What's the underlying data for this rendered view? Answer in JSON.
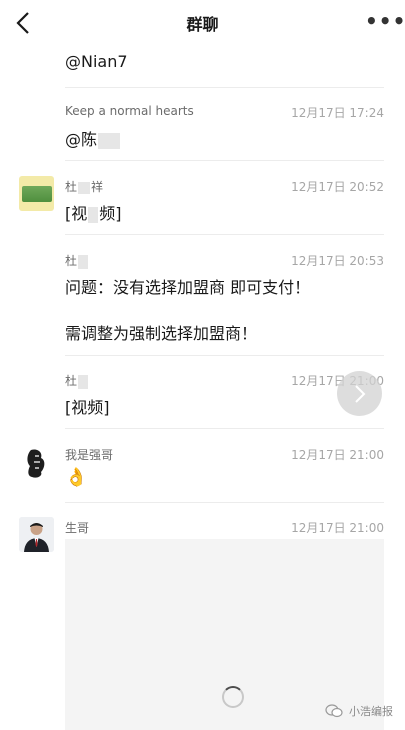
{
  "navbar": {
    "title": "群聊"
  },
  "messages": [
    {
      "id": "m0",
      "content": "@Nian7"
    },
    {
      "id": "m1",
      "sender": "Keep a normal hearts",
      "time": "12月17日 17:24",
      "content_prefix": "@陈"
    },
    {
      "id": "m2",
      "sender_a": "杜",
      "sender_b": "祥",
      "time": "12月17日 20:52",
      "content_a": "[视",
      "content_b": "频]",
      "avatar": "green-badge-avatar"
    },
    {
      "id": "m3",
      "sender_a": "杜",
      "time": "12月17日 20:53",
      "line1": "问题：没有选择加盟商  即可支付！",
      "line2": "需调整为强制选择加盟商！"
    },
    {
      "id": "m4",
      "sender_a": "杜",
      "time": "12月17日 21:00",
      "content": "[视频]"
    },
    {
      "id": "m5",
      "sender": "我是强哥",
      "time": "12月17日 21:00",
      "content": "👌",
      "avatar": "ink-portrait-avatar"
    },
    {
      "id": "m6",
      "sender": "生哥",
      "time": "12月17日 21:00",
      "avatar": "suit-portrait-avatar"
    }
  ],
  "watermark": {
    "text": "小浩编报"
  },
  "icons": {
    "back": "chevron-left-icon",
    "more": "more-dots-icon",
    "forward": "chevron-right-icon",
    "loading": "loading-spinner-icon"
  }
}
